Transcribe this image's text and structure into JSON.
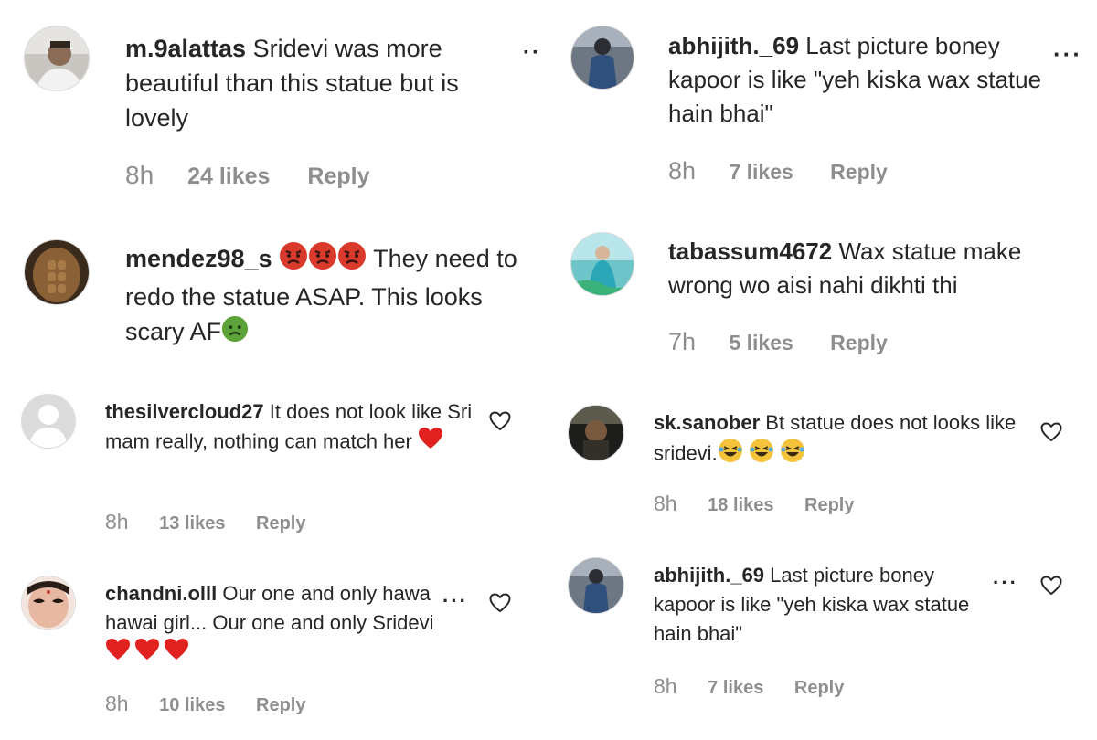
{
  "comments": [
    {
      "username": "m.9alattas",
      "text": "Sridevi was more beautiful than this statue but is lovely",
      "time": "8h",
      "likes": "24 likes",
      "reply": "Reply",
      "more": "··"
    },
    {
      "username": "abhijith._69",
      "text": "Last picture boney kapoor is like \"yeh kiska wax statue hain bhai\"",
      "time": "8h",
      "likes": "7 likes",
      "reply": "Reply",
      "more": "···"
    },
    {
      "username": "mendez98_s",
      "text_before_emoji": "",
      "text": "They need to redo the statue ASAP. This looks scary AF",
      "emoji_lead": "angry-face-emoji",
      "emoji_trail": "nauseated-face-emoji",
      "time": "",
      "likes": "",
      "reply": ""
    },
    {
      "username": "tabassum4672",
      "text": "Wax statue make wrong wo aisi nahi dikhti thi",
      "time": "7h",
      "likes": "5 likes",
      "reply": "Reply"
    },
    {
      "username": "thesilvercloud27",
      "text": "It does not look like Sri mam really, nothing can match her",
      "time": "8h",
      "likes": "13 likes",
      "reply": "Reply"
    },
    {
      "username": "sk.sanober",
      "text": "Bt statue does not looks like sridevi.",
      "time": "8h",
      "likes": "18 likes",
      "reply": "Reply"
    },
    {
      "username": "chandni.olll",
      "text": "Our one and only hawa hawai girl... Our one and only Sridevi",
      "time": "8h",
      "likes": "10 likes",
      "reply": "Reply",
      "more": "···"
    },
    {
      "username": "abhijith._69",
      "text": "Last picture boney kapoor is like \"yeh kiska wax statue hain bhai\"",
      "time": "8h",
      "likes": "7 likes",
      "reply": "Reply",
      "more": "···"
    }
  ],
  "colors": {
    "text": "#262626",
    "meta": "#8e8e8e",
    "heart_red": "#e0211f",
    "angry_red": "#d93a2b",
    "nausea_green": "#5ca33a",
    "laugh_yellow": "#f5c33b"
  }
}
